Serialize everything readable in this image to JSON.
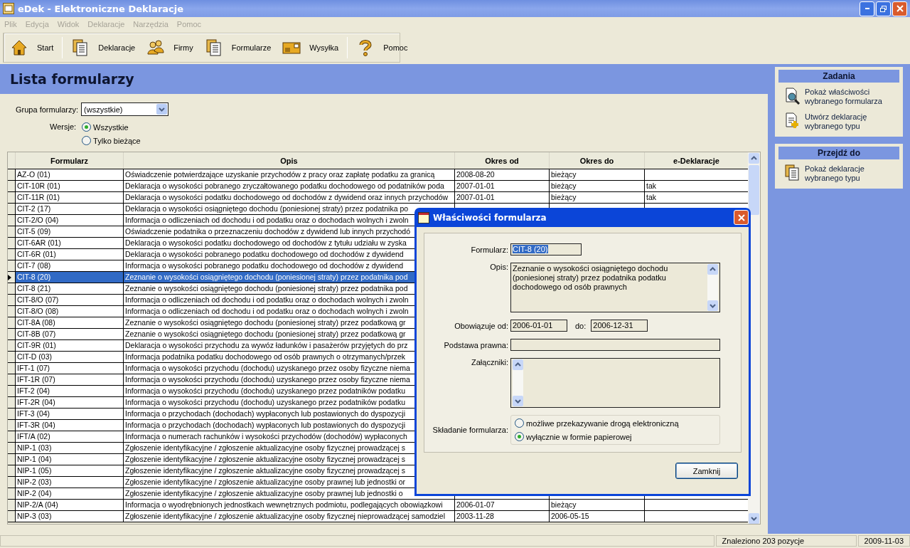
{
  "window": {
    "title": "eDek - Elektroniczne Deklaracje"
  },
  "menu": [
    "Plik",
    "Edycja",
    "Widok",
    "Deklaracje",
    "Narzędzia",
    "Pomoc"
  ],
  "toolbar": [
    {
      "label": "Start",
      "kind": "home"
    },
    {
      "label": "Deklaracje",
      "kind": "docs"
    },
    {
      "label": "Firmy",
      "kind": "people"
    },
    {
      "label": "Formularze",
      "kind": "forms"
    },
    {
      "label": "Wysyłka",
      "kind": "mail"
    },
    {
      "label": "Pomoc",
      "kind": "help"
    }
  ],
  "page_title": "Lista formularzy",
  "filters": {
    "group_label": "Grupa formularzy:",
    "group_value": "(wszystkie)",
    "versions_label": "Wersje:",
    "versions": [
      {
        "label": "Wszystkie",
        "selected": true
      },
      {
        "label": "Tylko bieżące",
        "selected": false
      }
    ]
  },
  "table": {
    "columns": [
      "Formularz",
      "Opis",
      "Okres od",
      "Okres do",
      "e-Deklaracje"
    ],
    "rows": [
      {
        "selected": false,
        "cells": [
          "AZ-O (01)",
          "Oświadczenie potwierdzające uzyskanie przychodów z pracy oraz zapłatę podatku za granicą",
          "2008-08-20",
          "bieżący"
        ]
      },
      {
        "selected": false,
        "cells": [
          "CIT-10R (01)",
          "Deklaracja o wysokości pobranego zryczałtowanego podatku dochodowego od podatników poda",
          "2007-01-01",
          "bieżący",
          "tak"
        ]
      },
      {
        "selected": false,
        "cells": [
          "CIT-11R (01)",
          "Deklaracja o wysokości podatku dochodowego od dochodów z dywidend oraz innych przychodów",
          "2007-01-01",
          "bieżący",
          "tak"
        ]
      },
      {
        "selected": false,
        "cells": [
          "CIT-2 (17)",
          "Deklaracja o wysokości osiągniętego dochodu (poniesionej straty) przez podatnika po"
        ]
      },
      {
        "selected": false,
        "cells": [
          "CIT-2/O (04)",
          "Informacja o odliczeniach od dochodu i od podatku oraz o dochodach wolnych i zwoln"
        ]
      },
      {
        "selected": false,
        "cells": [
          "CIT-5 (09)",
          "Oświadczenie podatnika o przeznaczeniu dochodów z dywidend lub innych przychodó"
        ]
      },
      {
        "selected": false,
        "cells": [
          "CIT-6AR (01)",
          "Deklaracja o wysokości podatku dochodowego od dochodów z tytułu udziału w zyska"
        ]
      },
      {
        "selected": false,
        "cells": [
          "CIT-6R (01)",
          "Deklaracja o wysokości pobranego podatku dochodowego od dochodów z dywidend"
        ]
      },
      {
        "selected": false,
        "cells": [
          "CIT-7 (08)",
          "Informacja o wysokości pobranego podatku dochodowego od dochodów z dywidend"
        ]
      },
      {
        "selected": true,
        "cells": [
          "CIT-8 (20)",
          "Zeznanie o wysokości osiągniętego dochodu (poniesionej straty) przez podatnika pod"
        ]
      },
      {
        "selected": false,
        "cells": [
          "CIT-8 (21)",
          "Zeznanie o wysokości osiągniętego dochodu (poniesionej straty) przez podatnika pod"
        ]
      },
      {
        "selected": false,
        "cells": [
          "CIT-8/O (07)",
          "Informacja o odliczeniach od dochodu i od podatku oraz o dochodach wolnych i zwoln"
        ]
      },
      {
        "selected": false,
        "cells": [
          "CIT-8/O (08)",
          "Informacja o odliczeniach od dochodu i od podatku oraz o dochodach wolnych i zwoln"
        ]
      },
      {
        "selected": false,
        "cells": [
          "CIT-8A (08)",
          "Zeznanie o wysokości osiągniętego dochodu (poniesionej straty) przez podatkową gr"
        ]
      },
      {
        "selected": false,
        "cells": [
          "CIT-8B (07)",
          "Zeznanie o wysokości osiągniętego dochodu (poniesionej straty) przez podatkową gr"
        ]
      },
      {
        "selected": false,
        "cells": [
          "CIT-9R (01)",
          "Deklaracja o wysokości przychodu za wywóz ładunków i pasażerów przyjętych do prz"
        ]
      },
      {
        "selected": false,
        "cells": [
          "CIT-D (03)",
          "Informacja podatnika podatku dochodowego od osób prawnych o otrzymanych/przek"
        ]
      },
      {
        "selected": false,
        "cells": [
          "IFT-1 (07)",
          "Informacja o wysokości przychodu (dochodu) uzyskanego przez osoby fizyczne niema"
        ]
      },
      {
        "selected": false,
        "cells": [
          "IFT-1R (07)",
          "Informacja o wysokości przychodu (dochodu) uzyskanego przez osoby fizyczne niema"
        ]
      },
      {
        "selected": false,
        "cells": [
          "IFT-2 (04)",
          "Informacja o wysokości przychodu (dochodu) uzyskanego przez podatników podatku"
        ]
      },
      {
        "selected": false,
        "cells": [
          "IFT-2R (04)",
          "Informacja o wysokości przychodu (dochodu) uzyskanego przez podatników podatku"
        ]
      },
      {
        "selected": false,
        "cells": [
          "IFT-3 (04)",
          "Informacja o przychodach (dochodach) wypłaconych lub postawionych do dyspozycji"
        ]
      },
      {
        "selected": false,
        "cells": [
          "IFT-3R (04)",
          "Informacja o przychodach (dochodach) wypłaconych lub postawionych do dyspozycji"
        ]
      },
      {
        "selected": false,
        "cells": [
          "IFT/A (02)",
          "Informacja o numerach rachunków i wysokości przychodów (dochodów) wypłaconych"
        ]
      },
      {
        "selected": false,
        "cells": [
          "NIP-1 (03)",
          "Zgłoszenie identyfikacyjne / zgłoszenie aktualizacyjne osoby fizycznej prowadzącej s"
        ]
      },
      {
        "selected": false,
        "cells": [
          "NIP-1 (04)",
          "Zgłoszenie identyfikacyjne / zgłoszenie aktualizacyjne osoby fizycznej prowadzącej s"
        ]
      },
      {
        "selected": false,
        "cells": [
          "NIP-1 (05)",
          "Zgłoszenie identyfikacyjne / zgłoszenie aktualizacyjne osoby fizycznej prowadzącej s"
        ]
      },
      {
        "selected": false,
        "cells": [
          "NIP-2 (03)",
          "Zgłoszenie identyfikacyjne / zgłoszenie aktualizacyjne osoby prawnej lub jednostki or"
        ]
      },
      {
        "selected": false,
        "cells": [
          "NIP-2 (04)",
          "Zgłoszenie identyfikacyjne / zgłoszenie aktualizacyjne osoby prawnej lub jednostki o"
        ]
      },
      {
        "selected": false,
        "cells": [
          "NIP-2/A (04)",
          "Informacja o wyodrębnionych jednostkach wewnętrznych podmiotu, podlegających obowiązkowi",
          "2006-01-07",
          "bieżący"
        ]
      },
      {
        "selected": false,
        "cells": [
          "NIP-3 (03)",
          "Zgłoszenie identyfikacyjne / zgłoszenie aktualizacyjne osoby fizycznej nieprowadzącej samodziel",
          "2003-11-28",
          "2006-05-15"
        ]
      }
    ]
  },
  "dialog": {
    "title": "Właściwości formularza",
    "form_label": "Formularz:",
    "form_value": "CIT-8 (20)",
    "desc_label": "Opis:",
    "desc_value": "Zeznanie o wysokości osiągniętego dochodu (poniesionej straty) przez podatnika podatku dochodowego od osób prawnych",
    "valid_label": "Obowiązuje od:",
    "valid_from": "2006-01-01",
    "to_label": "do:",
    "valid_to": "2006-12-31",
    "legal_label": "Podstawa prawna:",
    "attach_label": "Załączniki:",
    "submit_label": "Składanie formularza:",
    "submit_options": [
      {
        "label": "możliwe przekazywanie drogą elektroniczną",
        "selected": false
      },
      {
        "label": "wyłącznie w formie papierowej",
        "selected": true
      }
    ],
    "close_button": "Zamknij"
  },
  "tasks_panel": {
    "title": "Zadania",
    "items": [
      {
        "label": "Pokaż właściwości wybranego formularza",
        "kind": "inspect"
      },
      {
        "label": "Utwórz deklarację wybranego typu",
        "kind": "create"
      }
    ]
  },
  "goto_panel": {
    "title": "Przejdź do",
    "items": [
      {
        "label": "Pokaż deklaracje wybranego typu",
        "kind": "docs"
      }
    ]
  },
  "status_bar": {
    "count": "Znaleziono 203 pozycje",
    "date": "2009-11-03"
  }
}
